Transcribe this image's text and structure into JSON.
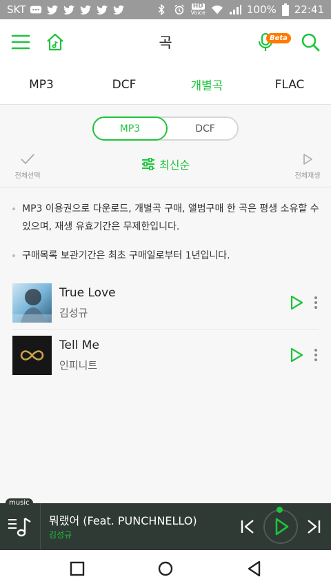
{
  "status_bar": {
    "carrier": "SKT",
    "hd_voice_top": "HD",
    "hd_voice_bottom": "Voice",
    "battery": "100%",
    "time": "22:41"
  },
  "header": {
    "title": "곡",
    "beta_label": "Beta"
  },
  "tabs": [
    {
      "label": "MP3",
      "active": false
    },
    {
      "label": "DCF",
      "active": false
    },
    {
      "label": "개별곡",
      "active": true
    },
    {
      "label": "FLAC",
      "active": false
    }
  ],
  "segment": {
    "options": [
      "MP3",
      "DCF"
    ],
    "selected": "MP3"
  },
  "toolbar": {
    "select_all_label": "전체선택",
    "sort_label": "최신순",
    "play_all_label": "전체재생"
  },
  "notices": [
    "MP3 이용권으로 다운로드, 개별곡 구매, 앨범구매 한 곡은 평생 소유할 수 있으며, 재생 유효기간은 무제한입니다.",
    "구매목록 보관기간은 최초 구매일로부터 1년입니다."
  ],
  "songs": [
    {
      "title": "True Love",
      "artist": "김성규"
    },
    {
      "title": "Tell Me",
      "artist": "인피니트"
    }
  ],
  "player": {
    "badge": "music",
    "track_title": "뭐랬어 (Feat. PUNCHNELLO)",
    "artist": "김성규"
  },
  "colors": {
    "accent": "#1cc43b",
    "player_bg": "#2f3a35",
    "beta": "#ff7a00"
  }
}
